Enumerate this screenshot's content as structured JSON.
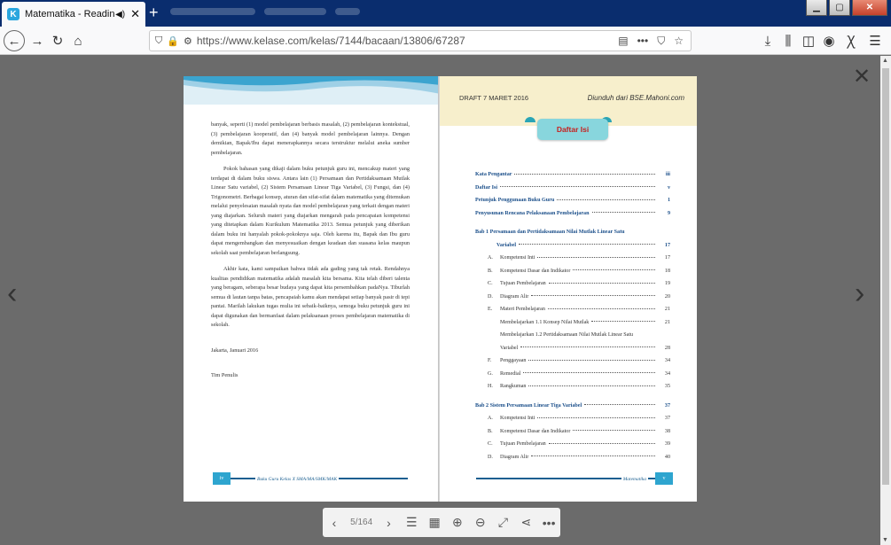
{
  "browser": {
    "tab_title": "Matematika - Reading",
    "tab_favicon": "K",
    "url": "https://www.kelase.com/kelas/7144/bacaan/13806/67287"
  },
  "viewer": {
    "page_indicator": "5/164"
  },
  "left_page": {
    "paragraphs": [
      "banyak, seperti (1) model pembelajaran berbasis masalah, (2) pembelajaran kontekstual, (3) pembelajaran kooperatif, dan (4) banyak model pembelajaran lainnya. Dengan demikian, Bapak/Ibu dapat menerapkannya secara terstruktur melalui aneka sumber pembelajaran.",
      "Pokok bahasan yang dikaji dalam buku petunjuk guru ini, mencakup materi yang terdapat di dalam buku siswa. Antara lain (1) Persamaan dan Pertidaksamaan Mutlak Linear Satu variabel, (2) Sistem Persamaan Linear Tiga Variabel, (3) Fungsi, dan (4) Trigonometri. Berbagai konsep, aturan dan sifat-sifat dalam matematika yang ditemukan melalui penyelesaian masalah nyata dan model pembelajaran yang terkait dengan materi yang diajarkan. Seluruh materi yang diajarkan mengarah pada pencapaian kompetensi yang ditetapkan dalam Kurikulum Matematika 2013. Semua petunjuk yang diberikan dalam buku ini hanyalah pokok-pokoknya saja. Oleh karena itu, Bapak dan Ibu guru dapat mengembangkan dan menyesuaikan dengan keadaan dan suasana kelas maupun sekolah saat pembelajaran berlangsung.",
      "Akhir kata, kami sampaikan bahwa tidak ada gading yang tak retak. Rendahnya kualitas pendidikan matematika adalah masalah kita bersama. Kita telah diberi talenta yang beragam, seberapa besar budaya yang dapat kita persembahkan padaNya. Tiburlah semua di lautan tanpa batas, pencapaiah kamu akan mendapat setiap banyak pasir di tepi pantai. Marilah lakukan tugas mulia ini sebaik-baiknya, semoga buku petunjuk guru ini dapat digunakan dan bermanfaat dalam pelaksanaan proses pembelajaran matematika di sekolah."
    ],
    "place_date": "Jakarta, Januari 2016",
    "signature": "Tim Penulis",
    "footer_page": "iv",
    "footer_text": "Buku Guru Kelas X SMA/MA/SMK/MAK"
  },
  "right_page": {
    "draft_label": "DRAFT 7 MARET 2016",
    "source_label": "Diunduh dari BSE.Mahoni.com",
    "toc_title": "Daftar Isi",
    "footer_page": "v",
    "footer_text": "Matematika",
    "toc": [
      {
        "style": "blue",
        "label": "Kata Pengantar",
        "page": "iii"
      },
      {
        "style": "blue",
        "label": "Daftar Isi",
        "page": "v"
      },
      {
        "style": "blue",
        "label": "Petunjuk Penggunaan Buku Guru",
        "page": "1"
      },
      {
        "style": "blue",
        "label": "Penyusunan Rencana Pelaksanaan Pembelajaran",
        "page": "9"
      },
      {
        "style": "space"
      },
      {
        "style": "blue-nodots",
        "label": "Bab 1   Persamaan dan Pertidaksamaan Nilai Mutlak Linear Satu",
        "page": ""
      },
      {
        "style": "indent2",
        "label": "Variabel",
        "page": "17"
      },
      {
        "style": "item",
        "letter": "A.",
        "label": "Kompetensi Inti",
        "page": "17"
      },
      {
        "style": "item",
        "letter": "B.",
        "label": "Kompetensi Dasar dan Indikator",
        "page": "18"
      },
      {
        "style": "item",
        "letter": "C.",
        "label": "Tujuan Pembelajaran",
        "page": "19"
      },
      {
        "style": "item",
        "letter": "D.",
        "label": "Diagram Alir",
        "page": "20"
      },
      {
        "style": "item",
        "letter": "E.",
        "label": "Materi Pembelajaran",
        "page": "21"
      },
      {
        "style": "indent",
        "label": "Membelajarkan 1.1 Konsep Nilai Mutlak",
        "page": "21"
      },
      {
        "style": "indent-nodots",
        "label": "Membelajarkan 1.2 Pertidaksamaan Nilai Mutlak Linear Satu",
        "page": ""
      },
      {
        "style": "indent",
        "label": "Variabel",
        "page": "28"
      },
      {
        "style": "item",
        "letter": "F.",
        "label": "Penggayaan",
        "page": "34"
      },
      {
        "style": "item",
        "letter": "G.",
        "label": "Remedial",
        "page": "34"
      },
      {
        "style": "item",
        "letter": "H.",
        "label": "Rangkuman",
        "page": "35"
      },
      {
        "style": "space"
      },
      {
        "style": "blue",
        "label": "Bab 2   Sistem Persamaan Linear Tiga Variabel",
        "page": "37"
      },
      {
        "style": "item",
        "letter": "A.",
        "label": "Kompetensi Inti",
        "page": "37"
      },
      {
        "style": "item",
        "letter": "B.",
        "label": "Kompetensi Dasar dan Indikator",
        "page": "38"
      },
      {
        "style": "item",
        "letter": "C.",
        "label": "Tujuan Pembelajaran",
        "page": "39"
      },
      {
        "style": "item",
        "letter": "D.",
        "label": "Diagram Alir",
        "page": "40"
      }
    ]
  },
  "colors": {
    "tabbar": "#0a2d6e",
    "viewer_bg": "#6b6b6b",
    "toc_blue": "#1b4f8a",
    "toc_title_red": "#c6201f",
    "toc_title_bg": "#88d6dd"
  }
}
